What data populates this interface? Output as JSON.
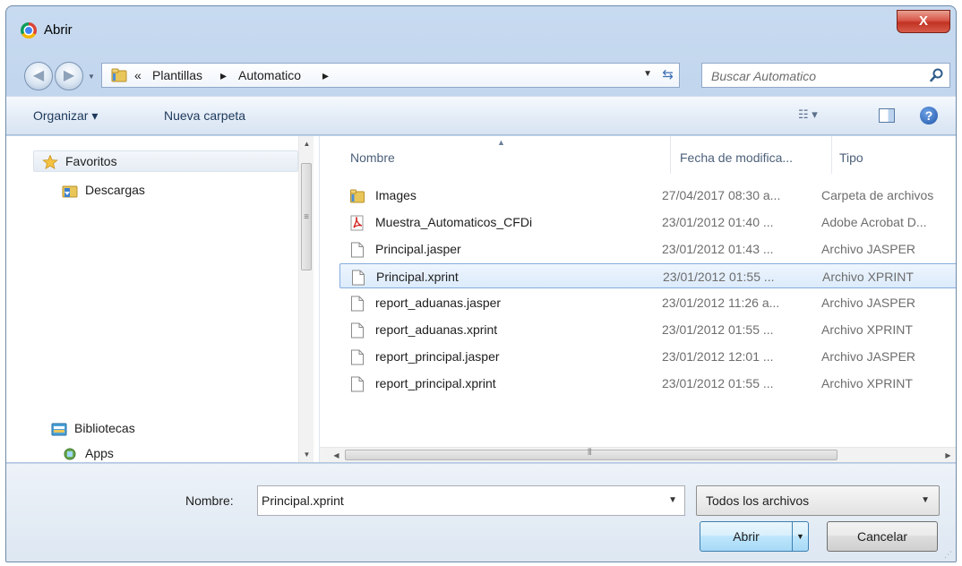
{
  "window": {
    "title": "Abrir",
    "close_label": "X"
  },
  "navigation": {
    "breadcrumb_prefix": "«",
    "breadcrumbs": [
      "Plantillas",
      "Automatico"
    ],
    "breadcrumb_separator": "▸",
    "search_placeholder": "Buscar Automatico"
  },
  "toolbar": {
    "organize_label": "Organizar ▾",
    "new_folder_label": "Nueva carpeta"
  },
  "nav_pane": {
    "favorites_label": "Favoritos",
    "downloads_label": "Descargas",
    "libraries_label": "Bibliotecas",
    "apps_label": "Apps"
  },
  "file_list": {
    "columns": {
      "name": "Nombre",
      "date": "Fecha de modifica...",
      "type": "Tipo"
    },
    "rows": [
      {
        "name": "Images",
        "date": "27/04/2017 08:30 a...",
        "type": "Carpeta de archivos",
        "icon": "folder-icon"
      },
      {
        "name": "Muestra_Automaticos_CFDi",
        "date": "23/01/2012 01:40 ...",
        "type": "Adobe Acrobat D...",
        "icon": "pdf-icon"
      },
      {
        "name": "Principal.jasper",
        "date": "23/01/2012 01:43 ...",
        "type": "Archivo JASPER",
        "icon": "file-icon"
      },
      {
        "name": "Principal.xprint",
        "date": "23/01/2012 01:55 ...",
        "type": "Archivo XPRINT",
        "icon": "file-icon",
        "selected": true
      },
      {
        "name": "report_aduanas.jasper",
        "date": "23/01/2012 11:26 a...",
        "type": "Archivo JASPER",
        "icon": "file-icon"
      },
      {
        "name": "report_aduanas.xprint",
        "date": "23/01/2012 01:55 ...",
        "type": "Archivo XPRINT",
        "icon": "file-icon"
      },
      {
        "name": "report_principal.jasper",
        "date": "23/01/2012 12:01 ...",
        "type": "Archivo JASPER",
        "icon": "file-icon"
      },
      {
        "name": "report_principal.xprint",
        "date": "23/01/2012 01:55 ...",
        "type": "Archivo XPRINT",
        "icon": "file-icon"
      }
    ]
  },
  "footer": {
    "filename_label": "Nombre:",
    "filename_value": "Principal.xprint",
    "filetype_value": "Todos los archivos",
    "open_label": "Abrir",
    "cancel_label": "Cancelar"
  },
  "colors": {
    "accent": "#3c7fb1",
    "selection_border": "#84acdd",
    "close_red": "#c23222"
  }
}
